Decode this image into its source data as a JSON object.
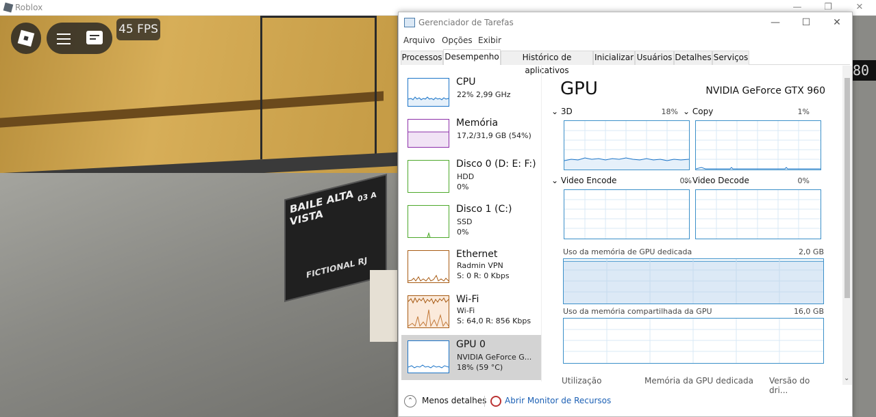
{
  "roblox": {
    "window_title": "Roblox",
    "fps_label": "45 FPS",
    "hud_counter": "80",
    "sign": {
      "line1": "BAILE ALTA VISTA",
      "line2": "FICTIONAL RJ",
      "line3": "03 A"
    }
  },
  "taskmanager": {
    "title": "Gerenciador de Tarefas",
    "menu": [
      "Arquivo",
      "Opções",
      "Exibir"
    ],
    "tabs": [
      "Processos",
      "Desempenho",
      "Histórico de aplicativos",
      "Inicializar",
      "Usuários",
      "Detalhes",
      "Serviços"
    ],
    "active_tab": "Desempenho",
    "resources": [
      {
        "name": "CPU",
        "sub1": "22% 2,99 GHz",
        "sub2": "",
        "color": "#1a73c7"
      },
      {
        "name": "Memória",
        "sub1": "17,2/31,9 GB (54%)",
        "sub2": "",
        "color": "#8b2da8"
      },
      {
        "name": "Disco 0 (D: E: F:)",
        "sub1": "HDD",
        "sub2": "0%",
        "color": "#4ca829"
      },
      {
        "name": "Disco 1 (C:)",
        "sub1": "SSD",
        "sub2": "0%",
        "color": "#4ca829"
      },
      {
        "name": "Ethernet",
        "sub1": "Radmin VPN",
        "sub2": "S: 0 R: 0 Kbps",
        "color": "#a75a12"
      },
      {
        "name": "Wi-Fi",
        "sub1": "Wi-Fi",
        "sub2": "S: 64,0 R: 856 Kbps",
        "color": "#a75a12"
      },
      {
        "name": "GPU 0",
        "sub1": "NVIDIA GeForce G...",
        "sub2": "18% (59 °C)",
        "color": "#1a73c7"
      }
    ],
    "gpu": {
      "title": "GPU",
      "model": "NVIDIA GeForce GTX 960",
      "engines": [
        {
          "label": "3D",
          "pct": "18%"
        },
        {
          "label": "Copy",
          "pct": "1%"
        },
        {
          "label": "Video Encode",
          "pct": "0%"
        },
        {
          "label": "Video Decode",
          "pct": "0%"
        }
      ],
      "dedicated_label": "Uso da memória de GPU dedicada",
      "dedicated_value": "2,0 GB",
      "dedicated_usage_fraction": 0.95,
      "shared_label": "Uso da memória compartilhada da GPU",
      "shared_value": "16,0 GB",
      "footer": [
        "Utilização",
        "Memória da GPU dedicada",
        "Versão do dri..."
      ]
    },
    "bottom": {
      "less_details": "Menos detalhes",
      "monitor": "Abrir Monitor de Recursos"
    }
  }
}
